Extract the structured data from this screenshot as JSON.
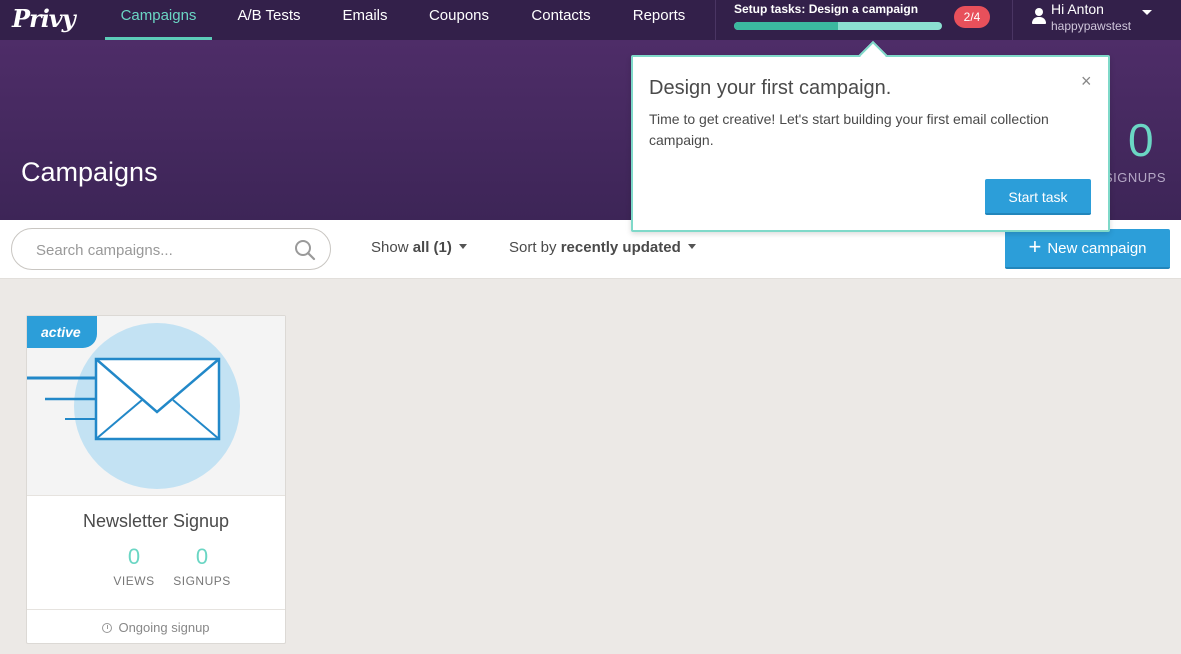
{
  "nav": {
    "logo": "Privy",
    "items": [
      {
        "label": "Campaigns",
        "active": true
      },
      {
        "label": "A/B Tests",
        "active": false
      },
      {
        "label": "Emails",
        "active": false
      },
      {
        "label": "Coupons",
        "active": false
      },
      {
        "label": "Contacts",
        "active": false
      },
      {
        "label": "Reports",
        "active": false
      }
    ],
    "setup": {
      "label": "Setup tasks: Design a campaign",
      "progress": 0.5,
      "badge": "2/4"
    },
    "user": {
      "greeting": "Hi Anton",
      "account": "happypawstest"
    }
  },
  "header": {
    "title": "Campaigns",
    "stat_value": "0",
    "stat_label": "SIGNUPS"
  },
  "toolbar": {
    "search_placeholder": "Search campaigns...",
    "show_prefix": "Show",
    "show_value": "all (1)",
    "sort_prefix": "Sort by",
    "sort_value": "recently updated",
    "new_label": "New campaign"
  },
  "campaigns": [
    {
      "status": "active",
      "name": "Newsletter Signup",
      "views": "0",
      "views_label": "VIEWS",
      "signups": "0",
      "signups_label": "SIGNUPS",
      "footer": "Ongoing signup"
    }
  ],
  "popover": {
    "title": "Design your first campaign.",
    "close": "×",
    "body": "Time to get creative! Let's start building your first email collection campaign.",
    "button": "Start task"
  },
  "colors": {
    "nav_bg": "#33204a",
    "header_bg": "#4e2d68",
    "accent_teal": "#6bd6c4",
    "primary_blue": "#2c9ed9",
    "badge_red": "#e8505b"
  },
  "icons": [
    "logo",
    "user-icon",
    "caret-down-icon",
    "search-icon",
    "plus-icon",
    "envelope-icon",
    "clock-icon",
    "close-icon"
  ]
}
